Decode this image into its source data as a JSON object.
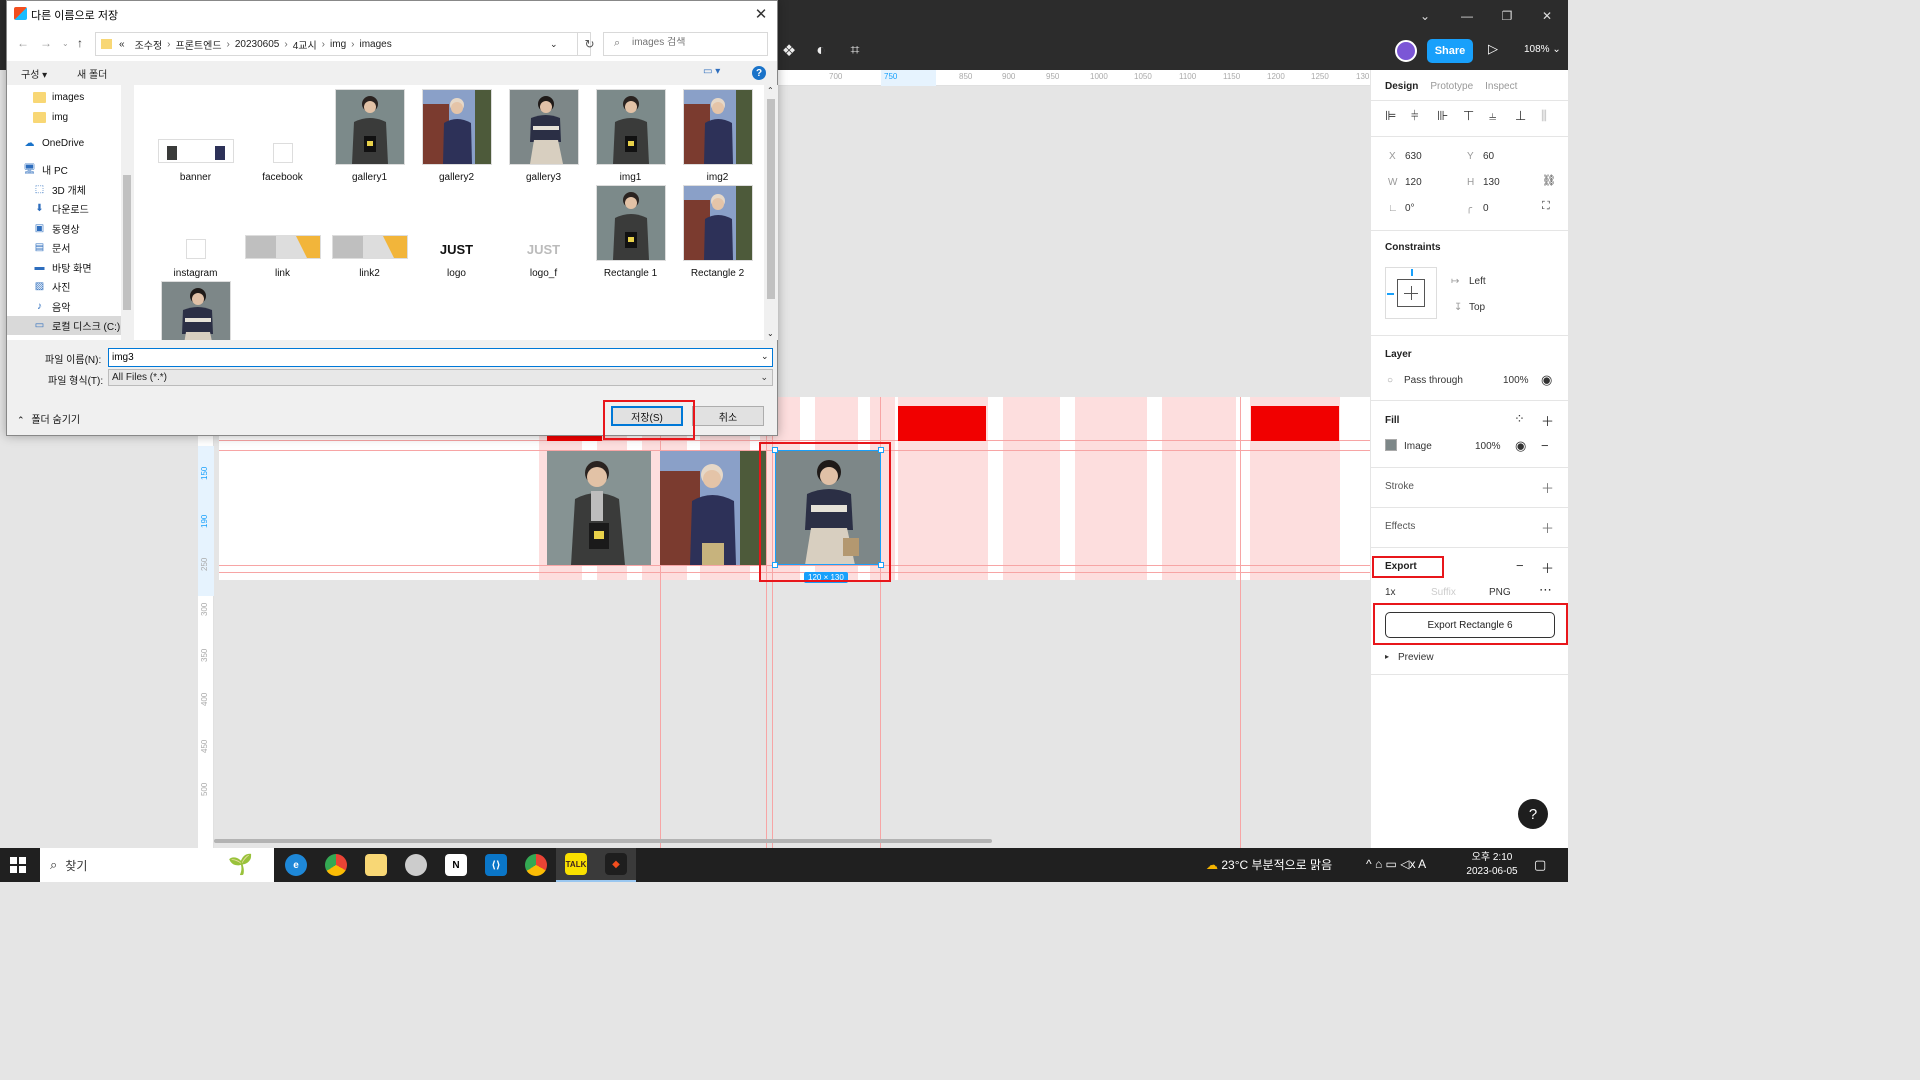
{
  "dialog": {
    "title": "다른 이름으로 저장",
    "close": "✕",
    "breadcrumb": [
      "«",
      "조수정",
      "프론트엔드",
      "20230605",
      "4교시",
      "img",
      "images"
    ],
    "breadcrumb_sep": "›",
    "search_placeholder": "images 검색",
    "organize_label": "구성 ▾",
    "new_folder_label": "새 폴더",
    "help_glyph": "?",
    "nav_tree": [
      {
        "label": "images",
        "icon": "folder"
      },
      {
        "label": "img",
        "icon": "folder"
      },
      {
        "label": "OneDrive",
        "icon": "cloud"
      },
      {
        "label": "내 PC",
        "icon": "pc"
      },
      {
        "label": "3D 개체",
        "icon": "3d"
      },
      {
        "label": "다운로드",
        "icon": "download"
      },
      {
        "label": "동영상",
        "icon": "video"
      },
      {
        "label": "문서",
        "icon": "doc"
      },
      {
        "label": "바탕 화면",
        "icon": "desktop"
      },
      {
        "label": "사진",
        "icon": "picture"
      },
      {
        "label": "음악",
        "icon": "music"
      },
      {
        "label": "로컬 디스크 (C:)",
        "icon": "drive"
      }
    ],
    "files": [
      {
        "name": "banner",
        "kind": "banner"
      },
      {
        "name": "facebook",
        "kind": "blank"
      },
      {
        "name": "gallery1",
        "kind": "photo-boy"
      },
      {
        "name": "gallery2",
        "kind": "photo-girl"
      },
      {
        "name": "gallery3",
        "kind": "photo-girl2"
      },
      {
        "name": "img1",
        "kind": "photo-boy"
      },
      {
        "name": "img2",
        "kind": "photo-girl"
      },
      {
        "name": "instagram",
        "kind": "blank"
      },
      {
        "name": "link",
        "kind": "link"
      },
      {
        "name": "link2",
        "kind": "link"
      },
      {
        "name": "logo",
        "kind": "logo"
      },
      {
        "name": "logo_f",
        "kind": "logo-faded"
      },
      {
        "name": "Rectangle 1",
        "kind": "photo-boy"
      },
      {
        "name": "Rectangle 2",
        "kind": "photo-girl"
      },
      {
        "name": "",
        "kind": "photo-girl2"
      }
    ],
    "logo_text": "JUST",
    "filename_label": "파일 이름(N):",
    "filename_value": "img3",
    "filetype_label": "파일 형식(T):",
    "filetype_value": "All Files (*.*)",
    "hide_folders": "폴더 숨기기",
    "save_label": "저장(S)",
    "cancel_label": "취소"
  },
  "figma": {
    "share_label": "Share",
    "zoom": "108%",
    "ruler_top": [
      "700",
      "750",
      "850",
      "900",
      "950",
      "1000",
      "1050",
      "1100",
      "1150",
      "1200",
      "1250",
      "130"
    ],
    "ruler_left": [
      "60",
      "100",
      "150",
      "190",
      "250",
      "300",
      "350",
      "400",
      "450",
      "500"
    ],
    "selection_size": "120 × 130",
    "panel": {
      "tabs": [
        "Design",
        "Prototype",
        "Inspect"
      ],
      "x_label": "X",
      "x": "630",
      "y_label": "Y",
      "y": "60",
      "w_label": "W",
      "w": "120",
      "h_label": "H",
      "h": "130",
      "rotation": "0°",
      "radius": "0",
      "constraints_title": "Constraints",
      "constraint_h": "Left",
      "constraint_v": "Top",
      "layer_title": "Layer",
      "blend": "Pass through",
      "layer_opacity": "100%",
      "fill_title": "Fill",
      "fill_type": "Image",
      "fill_opacity": "100%",
      "stroke_title": "Stroke",
      "effects_title": "Effects",
      "export_title": "Export",
      "export_scale": "1x",
      "export_suffix": "Suffix",
      "export_format": "PNG",
      "export_button": "Export Rectangle 6",
      "preview": "Preview"
    }
  },
  "taskbar": {
    "search_label": "찾기",
    "weather": "23°C  부분적으로 맑음",
    "time": "오후 2:10",
    "date": "2023-06-05",
    "tray": "^  ⌂  ▭  ◁x  A"
  },
  "colors": {
    "highlight_red": "#e8161b",
    "figma_blue": "#18a0fb",
    "layout_grid_pink": "#fddede",
    "block_red": "#f10000"
  }
}
